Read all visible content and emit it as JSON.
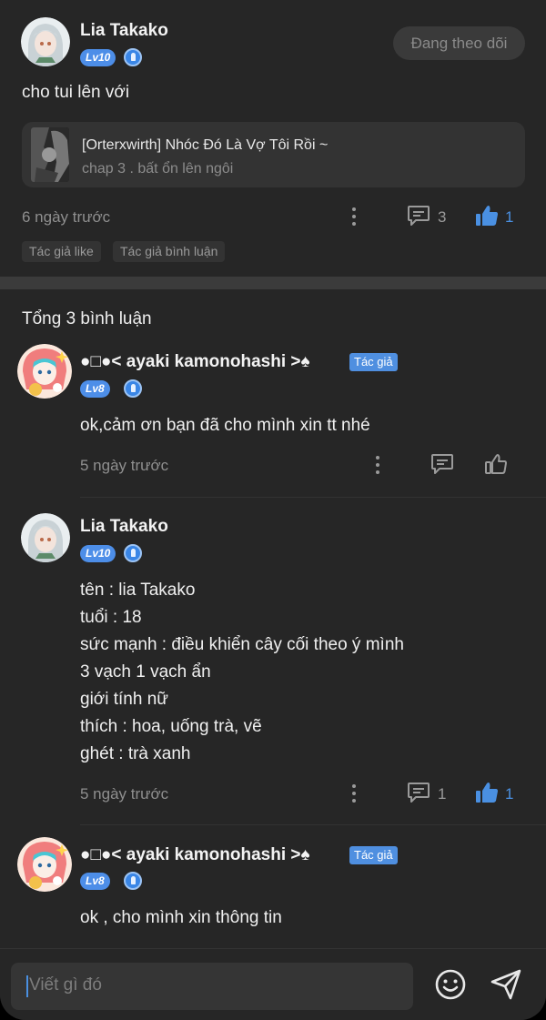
{
  "post": {
    "author": "Lia Takako",
    "level": "Lv10",
    "follow_label": "Đang theo dõi",
    "text": "cho tui lên với",
    "story": {
      "title": "[Orterxwirth] Nhóc Đó Là Vợ Tôi Rồi ~",
      "subtitle": "chap 3 . bất ổn lên ngôi"
    },
    "time": "6 ngày trước",
    "comment_count": "3",
    "like_count": "1",
    "tags": [
      "Tác giả like",
      "Tác giả bình luận"
    ]
  },
  "comments_header": "Tổng 3 bình luận",
  "comments": [
    {
      "author": "●□●< ayaki kamonohashi >♠",
      "badge": "Tác giả",
      "level": "Lv8",
      "lines": [
        "ok,cảm ơn bạn đã cho mình xin tt nhé"
      ],
      "time": "5 ngày trước",
      "comment_count": "",
      "like_count": ""
    },
    {
      "author": "Lia Takako",
      "badge": "",
      "level": "Lv10",
      "lines": [
        "tên : lia Takako",
        "tuổi : 18",
        "sức mạnh : điều khiển cây cối theo ý mình",
        "3 vạch 1 vạch ẩn",
        "giới tính nữ",
        "thích : hoa, uống trà, vẽ",
        "ghét : trà xanh"
      ],
      "time": "5 ngày trước",
      "comment_count": "1",
      "like_count": "1"
    },
    {
      "author": "●□●< ayaki kamonohashi >♠",
      "badge": "Tác giả",
      "level": "Lv8",
      "lines": [
        "ok , cho mình xin thông tin"
      ]
    }
  ],
  "composer": {
    "placeholder": "Viết gì đó"
  },
  "icons": {
    "emoji": "emoji-icon",
    "send": "send-icon",
    "comment": "comment-icon",
    "like": "thumbs-up-icon",
    "more": "more-vertical-icon"
  },
  "colors": {
    "background": "#262626",
    "accent": "#4a90e2",
    "level_badge": "#4d8ee8",
    "author_badge": "#4f8fe0"
  }
}
